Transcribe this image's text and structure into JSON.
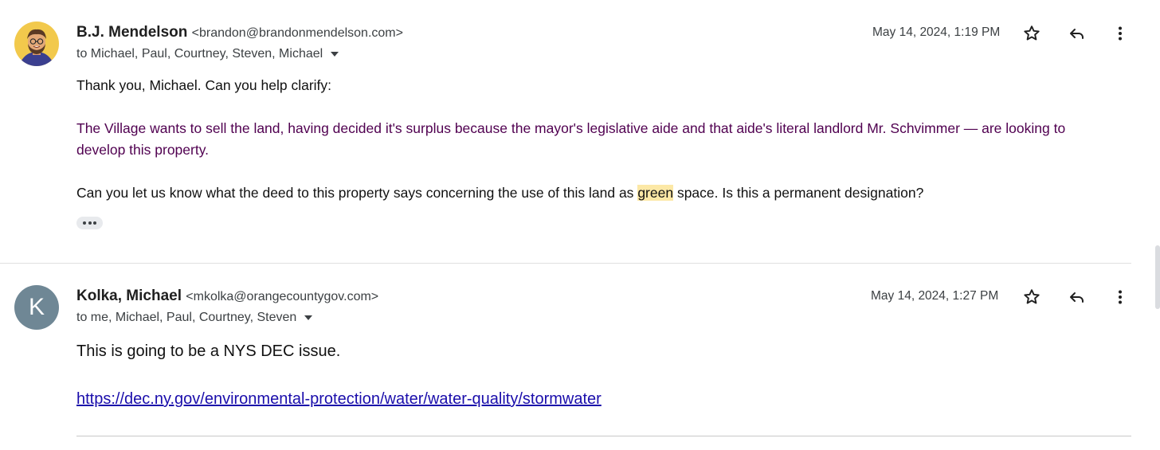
{
  "messages": [
    {
      "sender_name": "B.J. Mendelson",
      "sender_email": "<brandon@brandonmendelson.com>",
      "recipients": "to Michael, Paul, Courtney, Steven, Michael",
      "date": "May 14, 2024, 1:19 PM",
      "body": {
        "line1": "Thank you, Michael. Can you help clarify:",
        "quoted": "The Village wants to sell the land, having decided it's surplus because the mayor's legislative aide and that aide's literal landlord Mr. Schvimmer — are looking to develop this property.",
        "line3_before": "Can you let us know what the deed to this property says concerning the use of this land as ",
        "line3_highlight": "green",
        "line3_after": " space. Is this a permanent designation?"
      }
    },
    {
      "avatar_letter": "K",
      "sender_name": "Kolka, Michael",
      "sender_email": "<mkolka@orangecountygov.com>",
      "recipients": "to me, Michael, Paul, Courtney, Steven",
      "date": "May 14, 2024, 1:27 PM",
      "body": {
        "line1": "This is going to be a NYS DEC issue.",
        "link": "https://dec.ny.gov/environmental-protection/water/water-quality/stormwater"
      }
    }
  ],
  "icons": {
    "star": "star-icon",
    "reply": "reply-icon",
    "more": "more-vert-icon",
    "expand": "chevron-down-icon",
    "trimmed": "ellipsis-icon"
  },
  "colors": {
    "highlight": "#fce8a6",
    "quoted_text": "#500050",
    "link": "#1a0dab",
    "avatar_k": "#6f8795"
  }
}
